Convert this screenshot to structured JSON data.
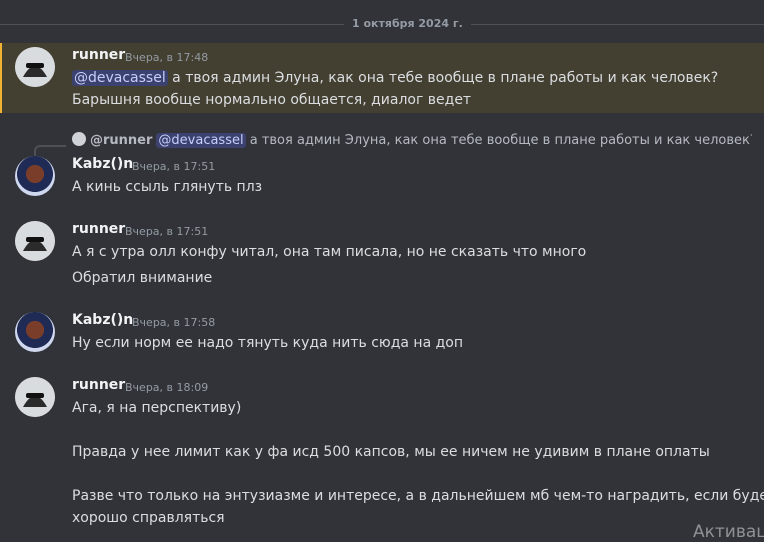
{
  "date_divider": "1 октября 2024 г.",
  "messages": [
    {
      "author": "runner",
      "time": "Вчера, в 17:48",
      "mention": "@devacassel",
      "line1": " а твоя админ Элуна, как она тебе вообще в плане работы и как человек?",
      "line2": "Барышня вообще нормально общается, диалог ведет"
    },
    {
      "reply": {
        "author": "@runner",
        "mention": "@devacassel",
        "text": " а твоя админ Элуна, как она тебе вообще в плане работы и как человек? Барышн..."
      },
      "author": "Kabz()n",
      "time": "Вчера, в 17:51",
      "line1": "А кинь ссыль глянуть плз"
    },
    {
      "author": "runner",
      "time": "Вчера, в 17:51",
      "line1": "А я с утра олл конфу читал, она там писала, но не сказать что много",
      "line2": "Обратил внимание"
    },
    {
      "author": "Kabz()n",
      "time": "Вчера, в 17:58",
      "line1": "Ну если норм ее надо тянуть куда нить сюда на доп"
    },
    {
      "author": "runner",
      "time": "Вчера, в 18:09",
      "line1": "Ага, я на перспективу)",
      "line2": "Правда у нее лимит как у фа исд 500 капсов, мы ее ничем не удивим в плане оплаты",
      "line3": "Разве что только на энтузиазме и интересе, а в дальнейшем мб чем-то наградить, если будет",
      "line4": "хорошо справляться"
    }
  ],
  "watermark": "Активац",
  "colors": {
    "background": "#313338",
    "highlight": "#433f31",
    "highlight_bar": "#f0b232",
    "mention_bg": "#3c4270"
  }
}
